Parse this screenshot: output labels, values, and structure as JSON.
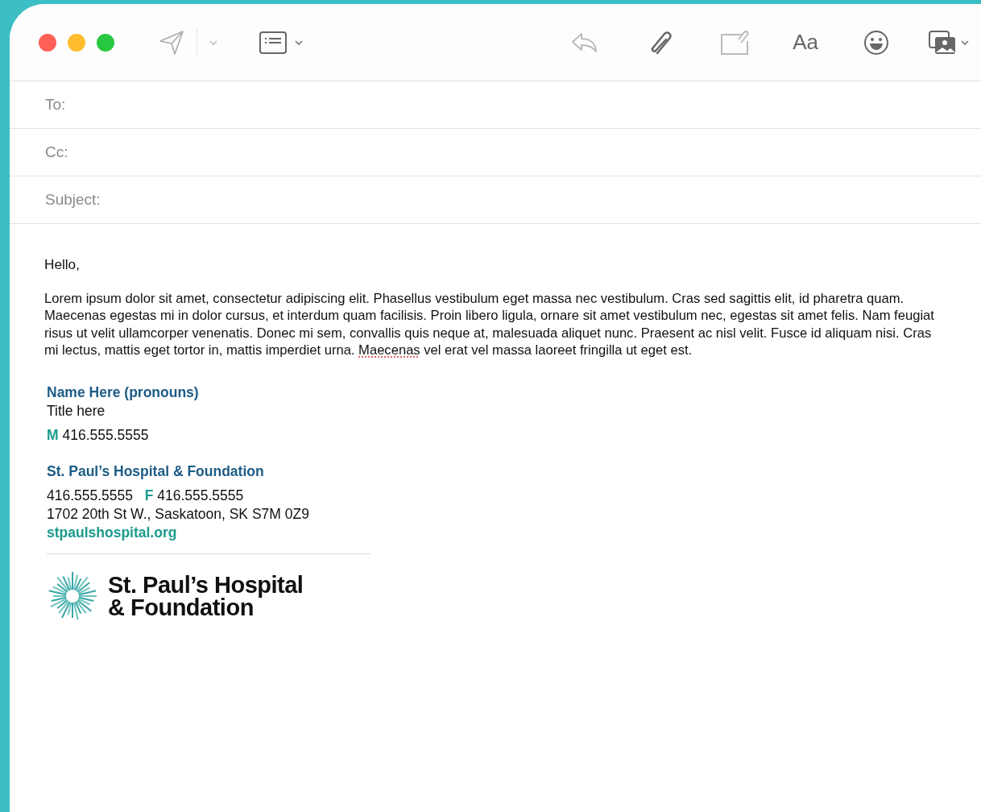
{
  "toolbar": {
    "format_label": "Aa"
  },
  "header_fields": [
    {
      "label": "To:"
    },
    {
      "label": "Cc:"
    },
    {
      "label": "Subject:"
    }
  ],
  "body": {
    "greeting": "Hello,",
    "paragraph": [
      {
        "text": "Lorem ipsum dolor sit amet, consectetur adipiscing elit. Phasellus vestibulum eget massa nec vestibulum. Cras sed sagittis elit, id pharetra quam. Maecenas egestas mi in dolor cursus, et interdum quam facilisis. Proin libero ligula, ornare sit amet vestibulum nec, egestas sit amet felis. Nam feugiat risus ut velit ullamcorper venenatis. Donec mi sem, convallis quis neque at, malesuada aliquet nunc. Praesent ac nisl velit. Fusce id aliquam nisi. Cras mi lectus, mattis eget tortor in, mattis imperdiet urna. ",
        "misspelled": false
      },
      {
        "text": "Maecenas",
        "misspelled": true
      },
      {
        "text": " vel erat vel massa laoreet fringilla ut eget est.",
        "misspelled": false
      }
    ]
  },
  "signature": {
    "name": "Name Here (pronouns)",
    "title": "Title here",
    "mobile": {
      "label": "M",
      "number": "416.555.5555"
    },
    "organization": "St. Paul’s Hospital & Foundation",
    "phone": "416.555.5555",
    "fax": {
      "label": "F",
      "number": "416.555.5555"
    },
    "address": "1702 20th St W., Saskatoon, SK S7M 0Z9",
    "website": "stpaulshospital.org",
    "logo_lines": [
      "St. Paul’s Hospital",
      "& Foundation"
    ]
  }
}
